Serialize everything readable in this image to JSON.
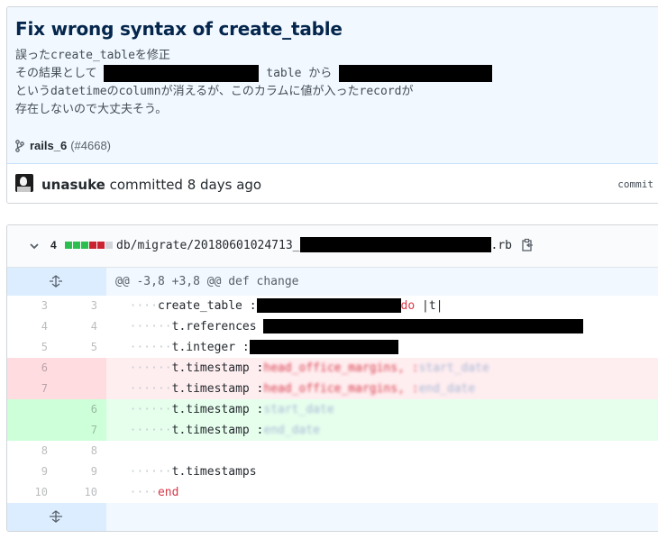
{
  "commit": {
    "title": "Fix wrong syntax of create_table",
    "description": {
      "line1": "誤ったcreate_tableを修正",
      "line2_prefix": "その結果として ",
      "line2_middle": " table から ",
      "line3": "というdatetimeのcolumnが消えるが、このカラムに値が入ったrecordが",
      "line4": "存在しないので大丈夫そう。"
    },
    "branch": "rails_6",
    "pr_ref": "(#4668)",
    "author": "unasuke",
    "action": "committed 8 days ago",
    "commit_label": "commit"
  },
  "file": {
    "change_count": "4",
    "path_prefix": "db/migrate/20180601024713_",
    "path_suffix": ".rb",
    "diffstat": [
      "add",
      "add",
      "add",
      "del",
      "del",
      "neu"
    ],
    "hunk_header": "@@ -3,8 +3,8 @@ def change",
    "lines": [
      {
        "type": "ctx",
        "old": "3",
        "new": "3",
        "ws": "····",
        "text": "create_table :",
        "kw": "do",
        "tail": " |t|"
      },
      {
        "type": "ctx",
        "old": "4",
        "new": "4",
        "ws": "······",
        "text": "t.references "
      },
      {
        "type": "ctx",
        "old": "5",
        "new": "5",
        "ws": "······",
        "text": "t.integer :"
      },
      {
        "type": "del",
        "old": "6",
        "new": "",
        "ws": "······",
        "text": "t.timestamp :",
        "blur_red": "head_office_margins, :",
        "blur_blue": "start_date"
      },
      {
        "type": "del",
        "old": "7",
        "new": "",
        "ws": "······",
        "text": "t.timestamp :",
        "blur_red": "head_office_margins, :",
        "blur_blue": "end_date"
      },
      {
        "type": "add",
        "old": "",
        "new": "6",
        "ws": "······",
        "text": "t.timestamp :",
        "blur_blue": "start_date"
      },
      {
        "type": "add",
        "old": "",
        "new": "7",
        "ws": "······",
        "text": "t.timestamp :",
        "blur_blue": "end_date"
      },
      {
        "type": "ctx",
        "old": "8",
        "new": "8",
        "ws": "",
        "text": ""
      },
      {
        "type": "ctx",
        "old": "9",
        "new": "9",
        "ws": "······",
        "text": "t.timestamps"
      },
      {
        "type": "ctx",
        "old": "10",
        "new": "10",
        "ws": "····",
        "text": "",
        "kw": "end"
      }
    ]
  },
  "icons": {
    "branch": "git-branch-icon",
    "chevron": "chevron-down-icon",
    "copy": "clippy-icon",
    "expand_up": "unfold-up-icon",
    "expand_down": "unfold-down-icon"
  },
  "colors": {
    "header_bg": "#f1f8ff",
    "title": "#05264c",
    "addition": "#e6ffed",
    "deletion": "#ffeef0",
    "keyword": "#d73a49"
  }
}
